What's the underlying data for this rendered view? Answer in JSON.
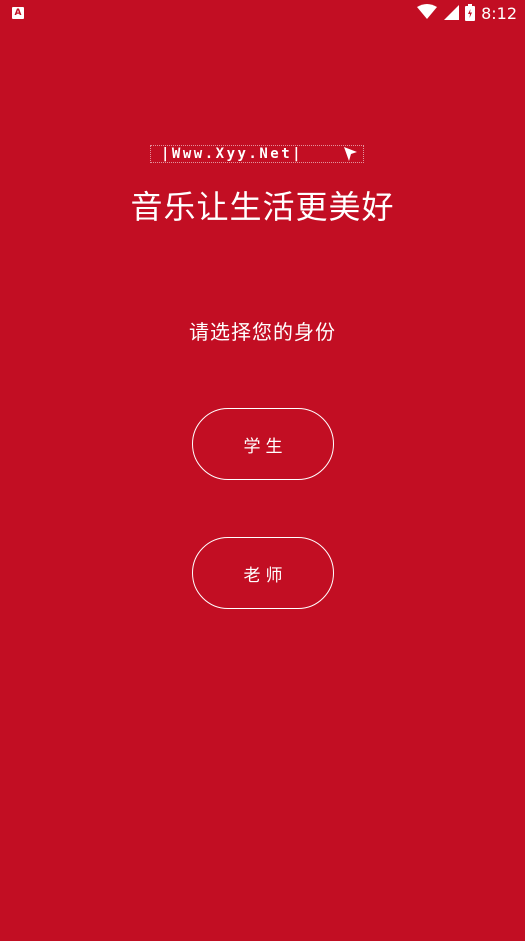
{
  "status_bar": {
    "left_icon": "A",
    "time": "8:12",
    "icons": [
      "wifi-icon",
      "signal-icon",
      "battery-icon"
    ]
  },
  "watermark": {
    "text": "|Www.Xyy.Net|",
    "icon": "cursor-arrow-icon"
  },
  "slogan": "音乐让生活更美好",
  "prompt": "请选择您的身份",
  "roles": {
    "student_label": "学生",
    "teacher_label": "老师"
  },
  "colors": {
    "background": "#c20e23",
    "foreground": "#ffffff"
  }
}
